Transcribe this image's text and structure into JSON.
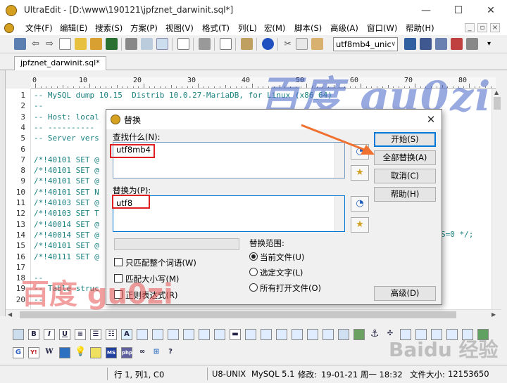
{
  "window": {
    "title": "UltraEdit - [D:\\www\\190121\\jpfznet_darwinit.sql*]",
    "minimize": "—",
    "maximize": "☐",
    "close": "✕"
  },
  "menu": {
    "items": [
      "文件(F)",
      "编辑(E)",
      "搜索(S)",
      "方案(P)",
      "视图(V)",
      "格式(T)",
      "列(L)",
      "宏(M)",
      "脚本(S)",
      "高级(A)",
      "窗口(W)",
      "帮助(H)"
    ],
    "mdi_min": "_",
    "mdi_restore": "▫",
    "mdi_close": "×"
  },
  "toolbar": {
    "encoding": "utf8mb4_unic"
  },
  "tab": {
    "filename": "jpfznet_darwinit.sql*"
  },
  "ruler": {
    "labels": [
      "0",
      "10",
      "20",
      "30",
      "40",
      "50",
      "60",
      "70",
      "80"
    ]
  },
  "editor": {
    "line_numbers": [
      "1",
      "2",
      "3",
      "4",
      "5",
      "6",
      "7",
      "8",
      "9",
      "10",
      "11",
      "12",
      "13",
      "14",
      "15",
      "16",
      "17",
      "18",
      "19",
      "20"
    ],
    "lines": [
      "-- MySQL dump 10.15  Distrib 10.0.27-MariaDB, for Linux (x86_64)",
      "--",
      "-- Host: local",
      "-- ----------",
      "-- Server vers",
      "",
      "/*!40101 SET @",
      "/*!40101 SET @",
      "/*!40101 SET @",
      "/*!40101 SET N",
      "/*!40103 SET @",
      "/*!40103 SET T",
      "/*!40014 SET @",
      "/*!40014 SET @",
      "/*!40101 SET @",
      "/*!40111 SET @",
      "",
      "--",
      "-- Table struc",
      "--"
    ],
    "line13_tail": "S=0 */;"
  },
  "dialog": {
    "title": "替换",
    "find_label": "查找什么(N):",
    "find_value": "utf8mb4",
    "replace_label": "替换为(P):",
    "replace_value": "utf8",
    "buttons": {
      "start": "开始(S)",
      "replace_all": "全部替换(A)",
      "cancel": "取消(C)",
      "help": "帮助(H)",
      "advanced": "高级(D)"
    },
    "options": {
      "whole_word": "只匹配整个词语(W)",
      "match_case": "匹配大小写(M)",
      "regex": "正则表达式(R)"
    },
    "scope": {
      "label": "替换范围:",
      "current_file": "当前文件(U)",
      "selection": "选定文字(L)",
      "all_open": "所有打开文件(O)"
    }
  },
  "statusbar": {
    "position": "行 1, 列1, C0",
    "encoding": "U8-UNIX",
    "syntax": "MySQL 5.1",
    "modified": "修改:",
    "modified_date": "19-01-21 周一 18:32",
    "size_label": "文件大小:",
    "size": "12153650"
  },
  "watermarks": {
    "top": "百度 gu0zi",
    "bottom": "百度 gu0zi",
    "baidu": "Baidu 经验"
  },
  "colors": {
    "accent": "#0078d7",
    "highlight_red": "#e02020",
    "code_teal": "#1a8080",
    "arrow_orange": "#f07030"
  }
}
